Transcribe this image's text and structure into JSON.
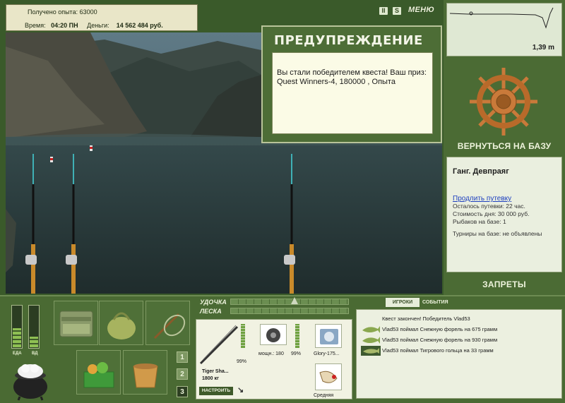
{
  "status": {
    "experience_label": "Получено опыта:",
    "experience_value": "63000",
    "time_label": "Время:",
    "time_value": "04:20 ПН",
    "money_label": "Деньги:",
    "money_value": "14 562 484 руб."
  },
  "top_controls": {
    "pause_icon": "pause-icon",
    "pause_label": "II",
    "sound_icon": "sound-icon",
    "sound_label": "S",
    "menu_label": "МЕНЮ"
  },
  "warning": {
    "title": "ПРЕДУПРЕЖДЕНИЕ",
    "message": "Вы стали победителем квеста! Ваш приз: Quest Winners-4, 180000 , Опыта"
  },
  "depth": {
    "value": "1,39 m"
  },
  "base": {
    "return_label": "ВЕРНУТЬСЯ НА БАЗУ",
    "location_name": "Ганг. Девпраяг",
    "extend_link": "Продлить путевку",
    "remaining": "Осталось путевки: 22 час.",
    "day_cost": "Стоимость дня: 30 000 руб.",
    "fishers": "Рыбаков на базе: 1",
    "tournaments": "Турниры на базе: не объявлены",
    "bans_label": "ЗАПРЕТЫ"
  },
  "meters": {
    "food_label": "ЕДА",
    "vodka_label": "ВД",
    "food_level": 0.45,
    "vodka_level": 0.25
  },
  "inventory": {
    "slots": [
      "tackle-box-icon",
      "bag-icon",
      "landing-net-icon",
      "food-basket-icon",
      "bait-bucket-icon"
    ],
    "pages": [
      "1",
      "2",
      "3"
    ]
  },
  "rod_bars": {
    "rod_label": "УДОЧКА",
    "line_label": "ЛЕСКА"
  },
  "tackle": {
    "rod_name": "Tiger Sha...",
    "rod_weight": "1800 кг",
    "rod_condition": "99%",
    "reel_name": "мощн.: 180",
    "reel_condition": "99%",
    "line_name": "Glory-175...",
    "lure_name": "Средняя",
    "tune_label": "НАСТРОИТЬ"
  },
  "events": {
    "tab_players": "ИГРОКИ",
    "tab_events": "СОБЫТИЯ",
    "rows": [
      {
        "icon": "",
        "text": "Квест закончен! Победитель Vlad53"
      },
      {
        "icon": "trout-icon",
        "text": "Vlad53 поймал Снежную форель на 675 грамм"
      },
      {
        "icon": "trout-icon",
        "text": "Vlad53 поймал Снежную форель на 930 грамм"
      },
      {
        "icon": "char-icon",
        "text": "Vlad53 поймал Тигрового гольца на 33 грамм"
      }
    ]
  },
  "colors": {
    "panel_green": "#4a6a33",
    "cream": "#e9e6c8",
    "link_blue": "#1d3fbf"
  }
}
